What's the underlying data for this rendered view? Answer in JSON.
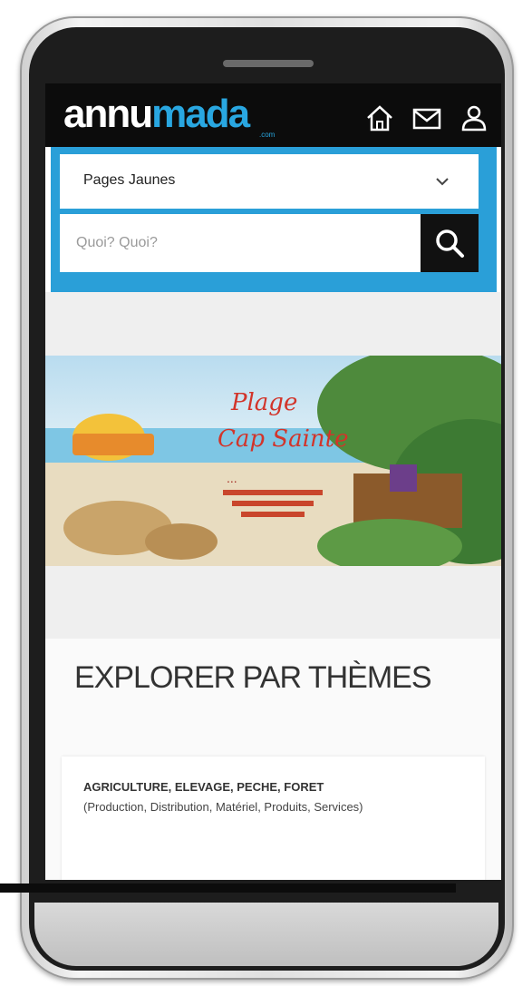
{
  "header": {
    "logo_part1": "annu",
    "logo_part2": "mada",
    "logo_sub": ".com",
    "icons": [
      "home-icon",
      "mail-icon",
      "user-icon"
    ]
  },
  "search": {
    "category_value": "Pages Jaunes",
    "placeholder": "Quoi? Quoi?",
    "button_icon": "search-icon"
  },
  "banner": {
    "line1": "Plage",
    "line2": "Cap Sainte",
    "line3": "...",
    "image_name": "beach-resort-promo"
  },
  "main": {
    "section_title": "EXPLORER PAR THÈMES",
    "cards": [
      {
        "title": "AGRICULTURE, ELEVAGE, PECHE, FORET",
        "description": "(Production, Distribution, Matériel, Produits, Services)"
      }
    ]
  },
  "colors": {
    "accent": "#29a7e1",
    "header_bg": "#0c0c0c",
    "search_panel": "#2a9fd8"
  }
}
